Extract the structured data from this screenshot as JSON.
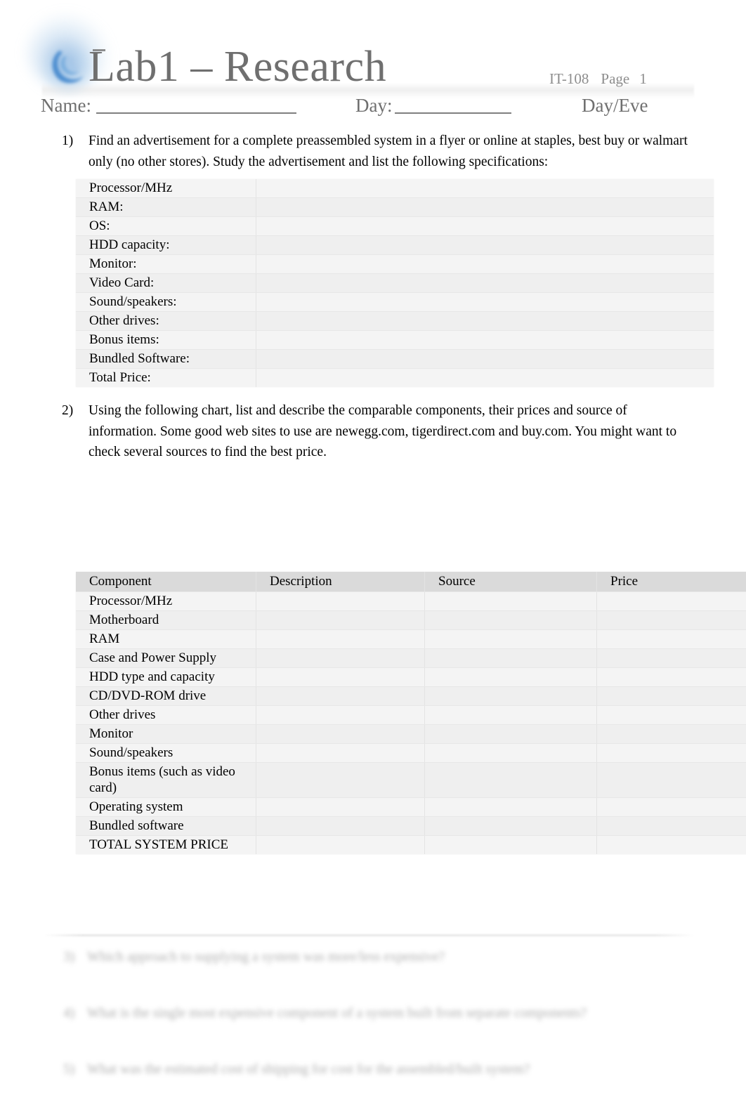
{
  "header": {
    "logo_icon": "blue-swirl-logo-icon",
    "title": "Lab1 – Research",
    "course_code": "IT-108",
    "page_label": "Page",
    "page_number": "1",
    "name_label": "Name:",
    "day_label": "Day:",
    "day_eve_label": "Day/Eve",
    "title_color": "#6f6f6f",
    "meta_color": "#8d8d8d"
  },
  "questions": [
    {
      "number": "1)",
      "text": "Find an advertisement for a complete preassembled system in a flyer or online at staples, best buy or walmart only (no other stores). Study the advertisement and list the following specifications:"
    },
    {
      "number": "2)",
      "text": "Using the following chart, list and describe the comparable components, their prices and source of information. Some good web sites to use are newegg.com, tigerdirect.com and buy.com. You might want to check several sources to find the best price."
    }
  ],
  "system_table": {
    "rows": [
      {
        "label": "Processor/MHz",
        "value": ""
      },
      {
        "label": "RAM:",
        "value": ""
      },
      {
        "label": "OS:",
        "value": ""
      },
      {
        "label": "HDD capacity:",
        "value": ""
      },
      {
        "label": "Monitor:",
        "value": ""
      },
      {
        "label": "Video Card:",
        "value": ""
      },
      {
        "label": "Sound/speakers:",
        "value": ""
      },
      {
        "label": "Other drives:",
        "value": ""
      },
      {
        "label": "Bonus items:",
        "value": ""
      },
      {
        "label": "Bundled Software:",
        "value": ""
      },
      {
        "label": "Total Price:",
        "value": ""
      }
    ]
  },
  "components_table": {
    "headers": [
      "Component",
      "Description",
      "Source",
      "Price"
    ],
    "rows": [
      {
        "component": "Processor/MHz",
        "description": "",
        "source": "",
        "price": ""
      },
      {
        "component": "Motherboard",
        "description": "",
        "source": "",
        "price": ""
      },
      {
        "component": "RAM",
        "description": "",
        "source": "",
        "price": ""
      },
      {
        "component": "Case and Power Supply",
        "description": "",
        "source": "",
        "price": ""
      },
      {
        "component": "HDD type and capacity",
        "description": "",
        "source": "",
        "price": ""
      },
      {
        "component": "CD/DVD-ROM drive",
        "description": "",
        "source": "",
        "price": ""
      },
      {
        "component": "Other drives",
        "description": "",
        "source": "",
        "price": ""
      },
      {
        "component": "Monitor",
        "description": "",
        "source": "",
        "price": ""
      },
      {
        "component": "Sound/speakers",
        "description": "",
        "source": "",
        "price": ""
      },
      {
        "component": "Bonus items (such as video card)",
        "description": "",
        "source": "",
        "price": ""
      },
      {
        "component": "Operating system",
        "description": "",
        "source": "",
        "price": ""
      },
      {
        "component": "Bundled software",
        "description": "",
        "source": "",
        "price": ""
      },
      {
        "component": "TOTAL SYSTEM PRICE",
        "description": "",
        "source": "",
        "price": ""
      }
    ]
  },
  "faded_questions": [
    {
      "number": "3)",
      "text": "Which approach to supplying a system was more/less expensive?"
    },
    {
      "number": "4)",
      "text": "What is the single most expensive component of a system built from separate components?"
    },
    {
      "number": "5)",
      "text": "What was the estimated cost of shipping for cost for the assembled/built system?"
    }
  ]
}
